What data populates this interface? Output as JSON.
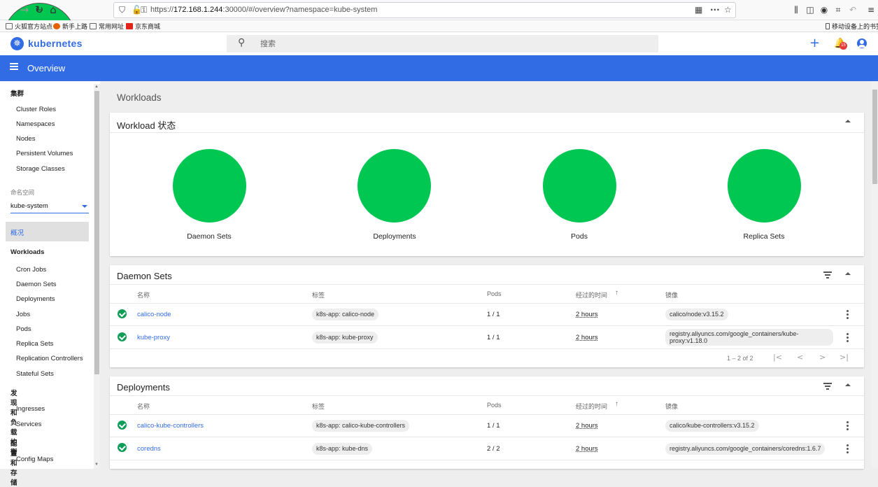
{
  "browser": {
    "url_prefix": "https://",
    "url_host": "172.168.1.244",
    "url_rest": ":30000/#/overview?namespace=kube-system",
    "bookmarks": [
      "火狐官方站点",
      "新手上路",
      "常用网址",
      "京东商城"
    ],
    "mobile_bookmarks": "移动设备上的书签"
  },
  "header": {
    "brand": "kubernetes",
    "search_placeholder": "搜索",
    "notification_count": "15"
  },
  "topbar": {
    "title": "Overview"
  },
  "sidebar": {
    "cluster_section": "集群",
    "cluster_items": [
      "Cluster Roles",
      "Namespaces",
      "Nodes",
      "Persistent Volumes",
      "Storage Classes"
    ],
    "namespace_label": "命名空间",
    "namespace_value": "kube-system",
    "overview": "概况",
    "workloads_section": "Workloads",
    "workload_items": [
      "Cron Jobs",
      "Daemon Sets",
      "Deployments",
      "Jobs",
      "Pods",
      "Replica Sets",
      "Replication Controllers",
      "Stateful Sets"
    ],
    "discovery_section": "发现和负载均衡",
    "discovery_items": [
      "Ingresses",
      "Services"
    ],
    "config_section": "配置和存储",
    "config_items": [
      "Config Maps"
    ]
  },
  "main": {
    "title": "Workloads",
    "status_card": {
      "title": "Workload 状态",
      "items": [
        "Daemon Sets",
        "Deployments",
        "Pods",
        "Replica Sets"
      ],
      "status_color": "#00c752"
    },
    "columns": {
      "name": "名称",
      "labels": "标签",
      "pods": "Pods",
      "age": "经过的时间",
      "images": "镜像"
    },
    "daemon_sets": {
      "title": "Daemon Sets",
      "rows": [
        {
          "name": "calico-node",
          "label": "k8s-app: calico-node",
          "pods": "1 / 1",
          "age": "2 hours",
          "image": "calico/node:v3.15.2"
        },
        {
          "name": "kube-proxy",
          "label": "k8s-app: kube-proxy",
          "pods": "1 / 1",
          "age": "2 hours",
          "image": "registry.aliyuncs.com/google_containers/kube-proxy:v1.18.0"
        }
      ],
      "pagination": "1 – 2 of 2"
    },
    "deployments": {
      "title": "Deployments",
      "rows": [
        {
          "name": "calico-kube-controllers",
          "label": "k8s-app: calico-kube-controllers",
          "pods": "1 / 1",
          "age": "2 hours",
          "image": "calico/kube-controllers:v3.15.2"
        },
        {
          "name": "coredns",
          "label": "k8s-app: kube-dns",
          "pods": "2 / 2",
          "age": "2 hours",
          "image": "registry.aliyuncs.com/google_containers/coredns:1.6.7"
        }
      ]
    }
  }
}
